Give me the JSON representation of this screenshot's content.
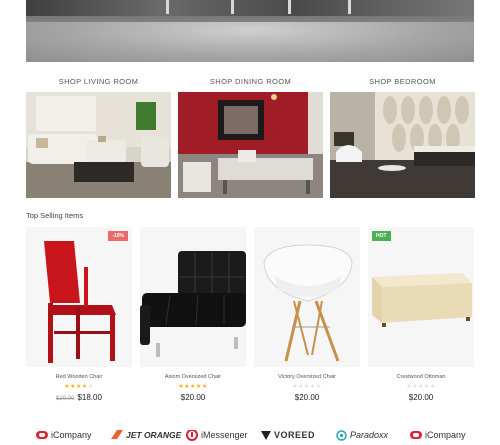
{
  "categories": [
    {
      "title": "SHOP LIVING ROOM"
    },
    {
      "title": "SHOP DINING ROOM"
    },
    {
      "title": "SHOP BEDROOM"
    }
  ],
  "section_title": "Top Selling Items",
  "products": [
    {
      "name": "Red Wooden Chair",
      "badge": "-10%",
      "rating": 4,
      "old_price": "$20.00",
      "price": "$18.00",
      "image_icon": "red-chair"
    },
    {
      "name": "Axiom Oversized Chair",
      "badge": "",
      "rating": 5,
      "old_price": "",
      "price": "$20.00",
      "image_icon": "black-leather-chair"
    },
    {
      "name": "Victory Oversized Chair",
      "badge": "",
      "rating": 0,
      "old_price": "",
      "price": "$20.00",
      "image_icon": "white-chair"
    },
    {
      "name": "Crestwood Ottoman",
      "badge": "HOT",
      "rating": 0,
      "old_price": "",
      "price": "$20.00",
      "image_icon": "ottoman"
    }
  ],
  "brands": [
    {
      "name": "iCompany",
      "color": "#d9232d",
      "icon": "icompany-logo"
    },
    {
      "name": "JET ORANGE",
      "color": "#e8642b",
      "icon": "jet-orange-logo"
    },
    {
      "name": "iMessenger",
      "color": "#d9232d",
      "icon": "imessenger-logo"
    },
    {
      "name": "VOREED",
      "color": "#222222",
      "icon": "voreed-logo"
    },
    {
      "name": "Paradoxx",
      "color": "#2aa3b8",
      "icon": "paradoxx-logo"
    },
    {
      "name": "iCompany",
      "color": "#d9232d",
      "icon": "icompany-logo"
    }
  ]
}
